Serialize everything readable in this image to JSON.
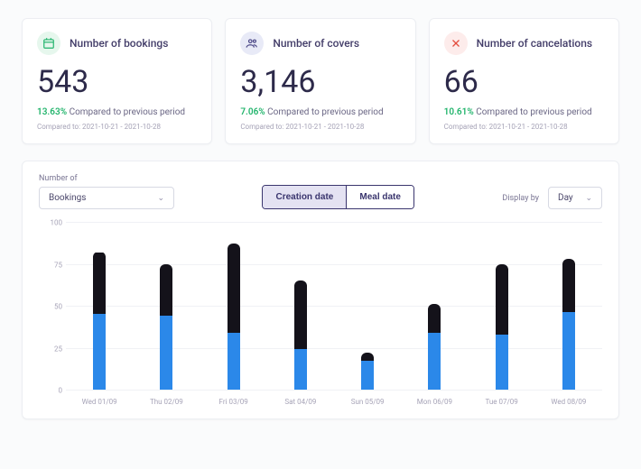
{
  "cards": [
    {
      "icon": "calendar",
      "icon_bg": "green",
      "title": "Number of bookings",
      "value": "543",
      "pct": "13.63%",
      "compare_text": "Compared to previous period",
      "range_prefix": "Compared to:",
      "range": "2021-10-21 - 2021-10-28"
    },
    {
      "icon": "users",
      "icon_bg": "blue",
      "title": "Number of covers",
      "value": "3,146",
      "pct": "7.06%",
      "compare_text": "Compared to previous period",
      "range_prefix": "Compared to:",
      "range": "2021-10-21 - 2021-10-28"
    },
    {
      "icon": "x",
      "icon_bg": "red",
      "title": "Number of cancelations",
      "value": "66",
      "pct": "10.61%",
      "compare_text": "Compared to previous period",
      "range_prefix": "Compared to:",
      "range": "2021-10-21 - 2021-10-28"
    }
  ],
  "panel": {
    "number_of_label": "Number of",
    "number_of_value": "Bookings",
    "seg_creation": "Creation date",
    "seg_meal": "Meal date",
    "display_by_label": "Display by",
    "display_by_value": "Day"
  },
  "chart_data": {
    "type": "bar",
    "ymax": 100,
    "ylabel": "",
    "yticks": [
      0,
      25,
      50,
      75,
      100
    ],
    "categories": [
      "Wed 01/09",
      "Thu 02/09",
      "Fri 03/09",
      "Sat 04/09",
      "Sun 05/09",
      "Mon 06/09",
      "Tue 07/09",
      "Wed 08/09"
    ],
    "series": [
      {
        "name": "series-a",
        "color": "#2b88e9",
        "values": [
          45,
          44,
          34,
          24,
          17,
          34,
          33,
          46
        ]
      },
      {
        "name": "series-b",
        "color": "#14121a",
        "values": [
          37,
          31,
          53,
          41,
          5,
          17,
          42,
          32
        ]
      }
    ],
    "totals": [
      82,
      75,
      87,
      65,
      22,
      51,
      75,
      78
    ]
  }
}
